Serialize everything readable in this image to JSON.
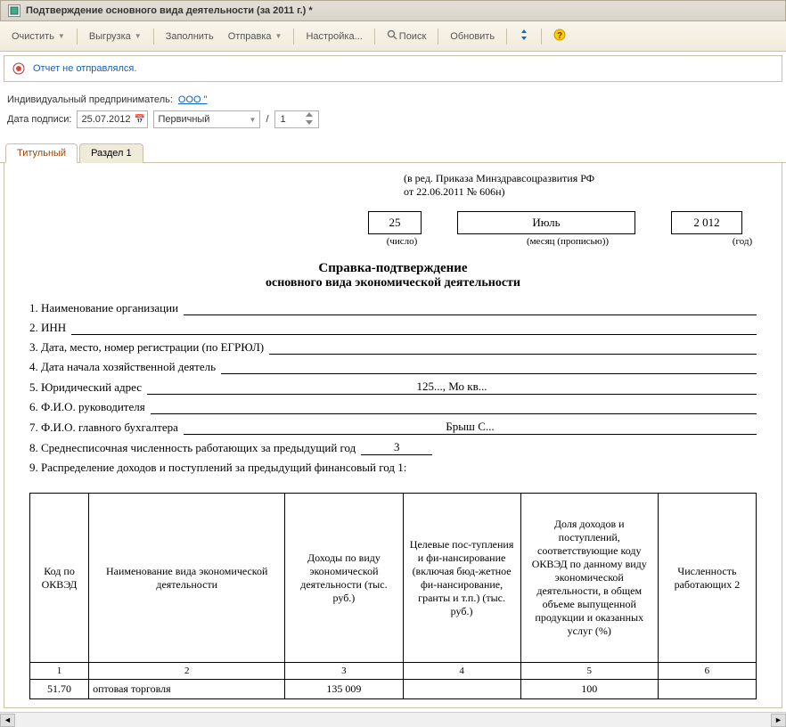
{
  "window": {
    "title": "Подтверждение основного вида деятельности  (за 2011 г.) *"
  },
  "toolbar": {
    "clear": "Очистить",
    "export": "Выгрузка",
    "fill": "Заполнить",
    "send": "Отправка",
    "settings": "Настройка...",
    "search": "Поиск",
    "refresh": "Обновить"
  },
  "status": {
    "text": "Отчет не отправлялся."
  },
  "params": {
    "ip_label": "Индивидуальный предприниматель:",
    "ip_value": "ООО \"",
    "date_label": "Дата подписи:",
    "date_value": "25.07.2012",
    "report_type": "Первичный",
    "slash": "/",
    "number": "1"
  },
  "tabs": {
    "title": "Титульный",
    "section1": "Раздел 1"
  },
  "doc": {
    "legal1": "(в ред. Приказа Минздравсоцразвития РФ",
    "legal2": "от 22.06.2011 № 606н)",
    "day": "25",
    "month": "Июль",
    "year": "2 012",
    "day_lbl": "(число)",
    "month_lbl": "(месяц (прописью))",
    "year_lbl": "(год)",
    "title1": "Справка-подтверждение",
    "title2": "основного вида экономической деятельности",
    "rows": {
      "r1_label": "1. Наименование организации",
      "r1_val": "",
      "r2_label": "2. ИНН",
      "r2_val": "",
      "r3_label": "3. Дата, место, номер регистрации (по ЕГРЮЛ)",
      "r3_val": "",
      "r4_label": "4. Дата начала хозяйственной деятель",
      "r4_val": "",
      "r5_label": "5. Юридический адрес",
      "r5_val": "125..., Мо кв...",
      "r6_label": "6. Ф.И.О. руководителя",
      "r6_val": "",
      "r7_label": "7. Ф.И.О. главного бухгалтера",
      "r7_val": "Брыш С...",
      "r8_label": "8. Среднесписочная численность работающих за предыдущий год",
      "r8_val": "3",
      "r9_label": "9. Распределение доходов и поступлений за предыдущий финансовый год 1:"
    },
    "table": {
      "h1": "Код по ОКВЭД",
      "h2": "Наименование вида экономической деятельности",
      "h3": "Доходы по виду экономической деятельности (тыс. руб.)",
      "h4": "Целевые пос-тупления и фи-нансирование (включая бюд-жетное фи-нансирование, гранты и т.п.) (тыс. руб.)",
      "h5": "Доля доходов и поступлений, соответствующие коду ОКВЭД по данному виду экономической деятельности, в общем объеме выпущенной продукции и оказанных услуг (%)",
      "h6": "Численность работающих 2",
      "n1": "1",
      "n2": "2",
      "n3": "3",
      "n4": "4",
      "n5": "5",
      "n6": "6",
      "d1": "51.70",
      "d2": "оптовая торговля",
      "d3": "135 009",
      "d4": "",
      "d5": "100",
      "d6": ""
    }
  }
}
